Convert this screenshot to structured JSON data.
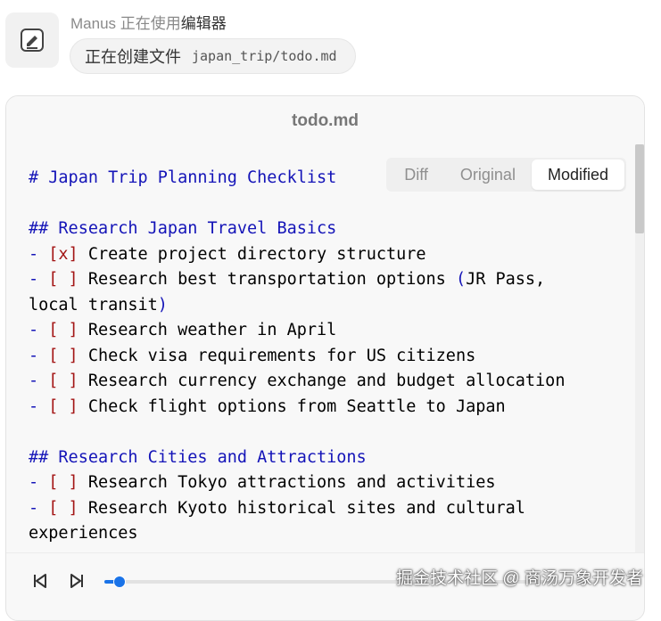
{
  "tool": {
    "label_prefix": "Manus 正在使用",
    "label_tool": "编辑器",
    "action_text": "正在创建文件",
    "action_path": "japan_trip/todo.md"
  },
  "panel": {
    "title": "todo.md",
    "tabs": [
      {
        "label": "Diff",
        "active": false
      },
      {
        "label": "Original",
        "active": false
      },
      {
        "label": "Modified",
        "active": true
      }
    ]
  },
  "editor": {
    "lines": [
      {
        "kind": "h1",
        "text": "# Japan Trip Planning Checklist"
      },
      {
        "kind": "blank",
        "text": ""
      },
      {
        "kind": "h2",
        "text": "## Research Japan Travel Basics"
      },
      {
        "kind": "task",
        "box": "[x]",
        "text": "Create project directory structure"
      },
      {
        "kind": "task",
        "box": "[ ]",
        "text": "Research best transportation options ",
        "paren_open": "(",
        "after_paren": "JR Pass,"
      },
      {
        "kind": "cont",
        "text": "local transit",
        "paren_close": ")"
      },
      {
        "kind": "task",
        "box": "[ ]",
        "text": "Research weather in April"
      },
      {
        "kind": "task",
        "box": "[ ]",
        "text": "Check visa requirements for US citizens"
      },
      {
        "kind": "task",
        "box": "[ ]",
        "text": "Research currency exchange and budget allocation"
      },
      {
        "kind": "task",
        "box": "[ ]",
        "text": "Check flight options from Seattle to Japan"
      },
      {
        "kind": "blank",
        "text": ""
      },
      {
        "kind": "h2",
        "text": "## Research Cities and Attractions"
      },
      {
        "kind": "task",
        "box": "[ ]",
        "text": "Research Tokyo attractions and activities"
      },
      {
        "kind": "task",
        "box": "[ ]",
        "text": "Research Kyoto historical sites and cultural"
      },
      {
        "kind": "cont",
        "text": "experiences"
      }
    ]
  },
  "player": {
    "progress": 0.03,
    "accent": "#1a73e8"
  },
  "watermark": "掘金技术社区 @ 商汤万象开发者"
}
